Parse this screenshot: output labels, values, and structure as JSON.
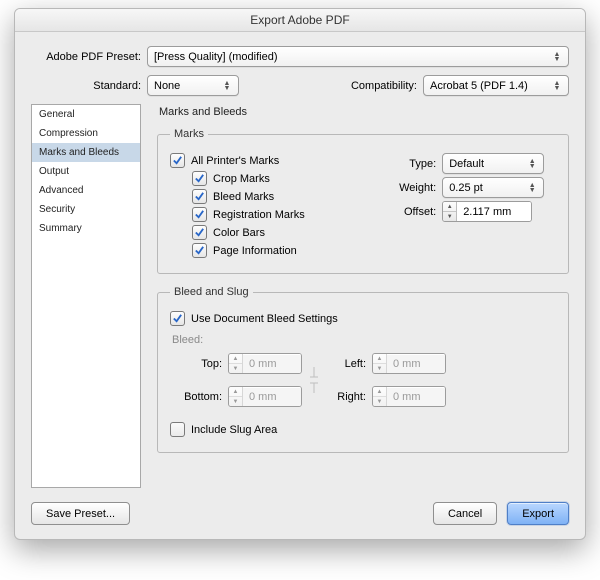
{
  "window": {
    "title": "Export Adobe PDF"
  },
  "top": {
    "preset_label": "Adobe PDF Preset:",
    "preset_value": "[Press Quality] (modified)",
    "standard_label": "Standard:",
    "standard_value": "None",
    "compat_label": "Compatibility:",
    "compat_value": "Acrobat 5 (PDF 1.4)"
  },
  "sidebar": {
    "items": [
      {
        "label": "General"
      },
      {
        "label": "Compression"
      },
      {
        "label": "Marks and Bleeds"
      },
      {
        "label": "Output"
      },
      {
        "label": "Advanced"
      },
      {
        "label": "Security"
      },
      {
        "label": "Summary"
      }
    ],
    "selected_index": 2
  },
  "panel": {
    "title": "Marks and Bleeds",
    "marks": {
      "legend": "Marks",
      "all_label": "All Printer's Marks",
      "crop_label": "Crop Marks",
      "bleed_label": "Bleed Marks",
      "registration_label": "Registration Marks",
      "color_bars_label": "Color Bars",
      "page_info_label": "Page Information",
      "type_label": "Type:",
      "type_value": "Default",
      "weight_label": "Weight:",
      "weight_value": "0.25 pt",
      "offset_label": "Offset:",
      "offset_value": "2.117 mm",
      "checks": {
        "all": true,
        "crop": true,
        "bleed": true,
        "registration": true,
        "color_bars": true,
        "page_info": true
      }
    },
    "bleed": {
      "legend": "Bleed and Slug",
      "use_doc_label": "Use Document Bleed Settings",
      "use_doc_checked": true,
      "bleed_label": "Bleed:",
      "top_label": "Top:",
      "top_value": "0 mm",
      "bottom_label": "Bottom:",
      "bottom_value": "0 mm",
      "left_label": "Left:",
      "left_value": "0 mm",
      "right_label": "Right:",
      "right_value": "0 mm",
      "include_slug_label": "Include Slug Area",
      "include_slug_checked": false
    }
  },
  "footer": {
    "save_preset": "Save Preset...",
    "cancel": "Cancel",
    "export": "Export"
  }
}
